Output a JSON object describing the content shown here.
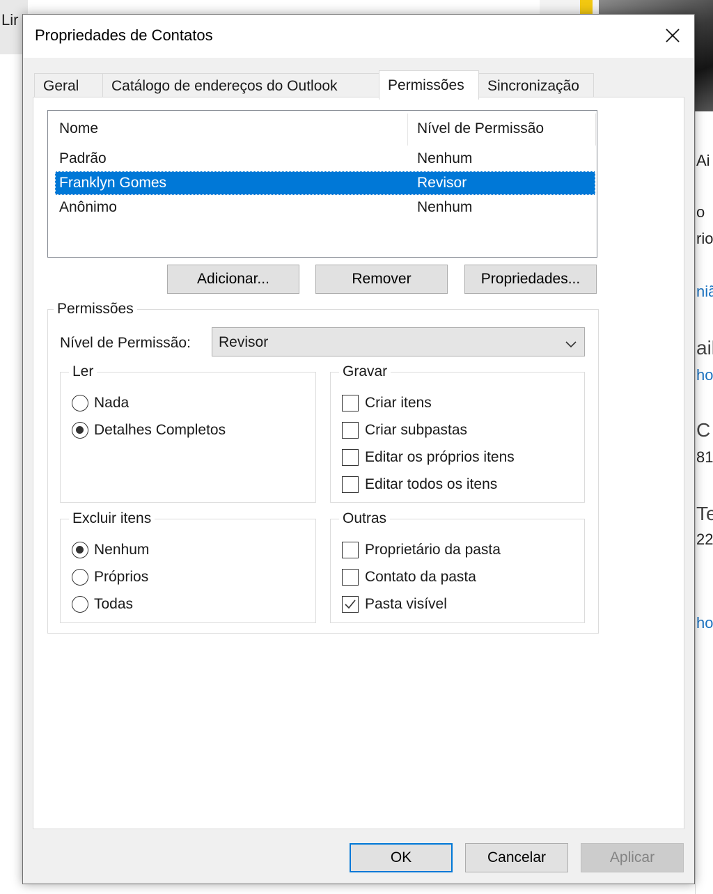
{
  "background": {
    "left_fragment": "Lir",
    "right_fragments": [
      "Ai",
      "o",
      "rio",
      "niã",
      "ail",
      "ho",
      "C",
      "81",
      "Te",
      "22",
      "ho"
    ]
  },
  "dialog": {
    "title": "Propriedades de Contatos",
    "tabs": [
      "Geral",
      "Catálogo de endereços do Outlook",
      "Permissões",
      "Sincronização"
    ],
    "active_tab": "Permissões"
  },
  "list": {
    "columns": [
      "Nome",
      "Nível de Permissão"
    ],
    "rows": [
      {
        "name": "Padrão",
        "level": "Nenhum",
        "selected": false
      },
      {
        "name": "Franklyn Gomes",
        "level": "Revisor",
        "selected": true
      },
      {
        "name": "Anônimo",
        "level": "Nenhum",
        "selected": false
      }
    ]
  },
  "list_buttons": {
    "add": "Adicionar...",
    "remove": "Remover",
    "properties": "Propriedades..."
  },
  "permissions": {
    "legend": "Permissões",
    "level_label": "Nível de Permissão:",
    "level_value": "Revisor",
    "read": {
      "legend": "Ler",
      "options": [
        "Nada",
        "Detalhes Completos"
      ],
      "selected": "Detalhes Completos"
    },
    "write": {
      "legend": "Gravar",
      "options": [
        {
          "label": "Criar itens",
          "checked": false
        },
        {
          "label": "Criar subpastas",
          "checked": false
        },
        {
          "label": "Editar os próprios itens",
          "checked": false
        },
        {
          "label": "Editar todos os itens",
          "checked": false
        }
      ]
    },
    "delete": {
      "legend": "Excluir itens",
      "options": [
        "Nenhum",
        "Próprios",
        "Todas"
      ],
      "selected": "Nenhum"
    },
    "other": {
      "legend": "Outras",
      "options": [
        {
          "label": "Proprietário da pasta",
          "checked": false
        },
        {
          "label": "Contato da pasta",
          "checked": false
        },
        {
          "label": "Pasta visível",
          "checked": true
        }
      ]
    }
  },
  "footer": {
    "ok": "OK",
    "cancel": "Cancelar",
    "apply": "Aplicar"
  },
  "colors": {
    "selection": "#0078d7",
    "dialog_bg": "#f0f0f0",
    "button_bg": "#e1e1e1"
  }
}
